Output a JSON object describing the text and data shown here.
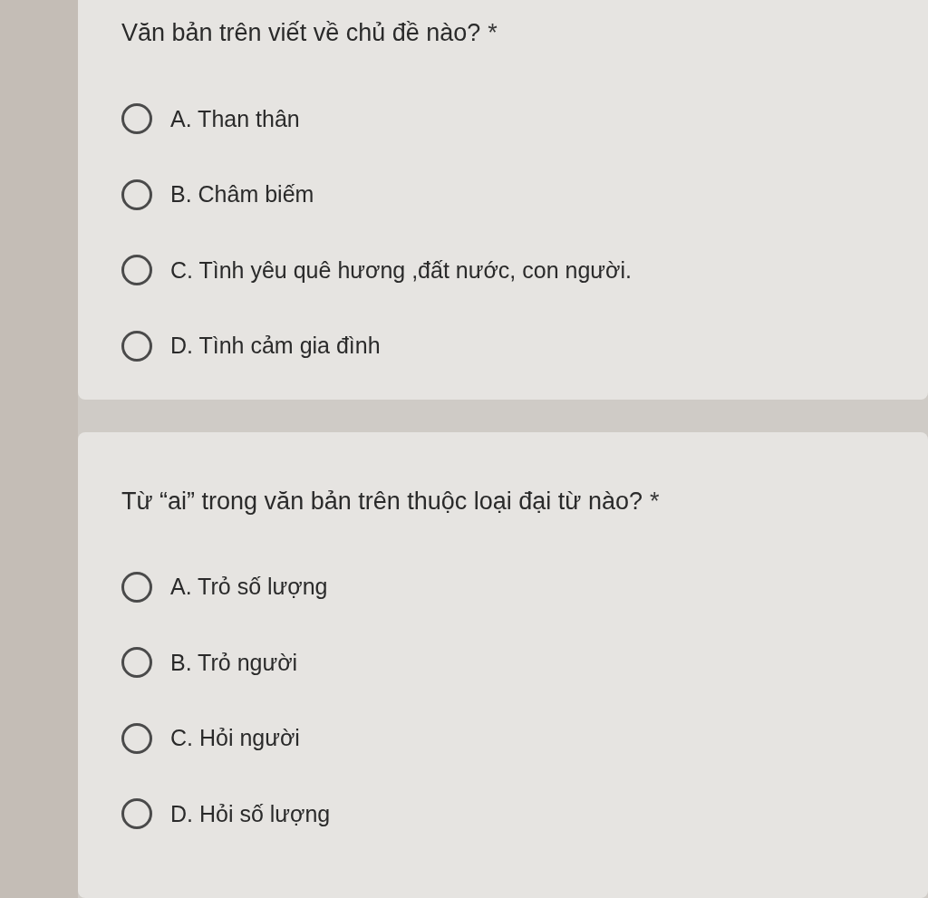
{
  "questions": [
    {
      "title": "Văn bản trên viết về chủ đề nào?",
      "required_mark": "*",
      "options": [
        {
          "label": "A. Than thân",
          "selected": false
        },
        {
          "label": "B. Châm biếm",
          "selected": false
        },
        {
          "label": "C. Tình yêu quê hương ,đất nước, con người.",
          "selected": false
        },
        {
          "label": "D. Tình cảm gia đình",
          "selected": false
        }
      ]
    },
    {
      "title": "Từ “ai” trong văn bản trên thuộc loại đại từ nào?",
      "required_mark": "*",
      "options": [
        {
          "label": "A. Trỏ số lượng",
          "selected": false
        },
        {
          "label": "B. Trỏ người",
          "selected": false
        },
        {
          "label": "C. Hỏi người",
          "selected": false
        },
        {
          "label": "D. Hỏi số lượng",
          "selected": false
        }
      ]
    }
  ]
}
